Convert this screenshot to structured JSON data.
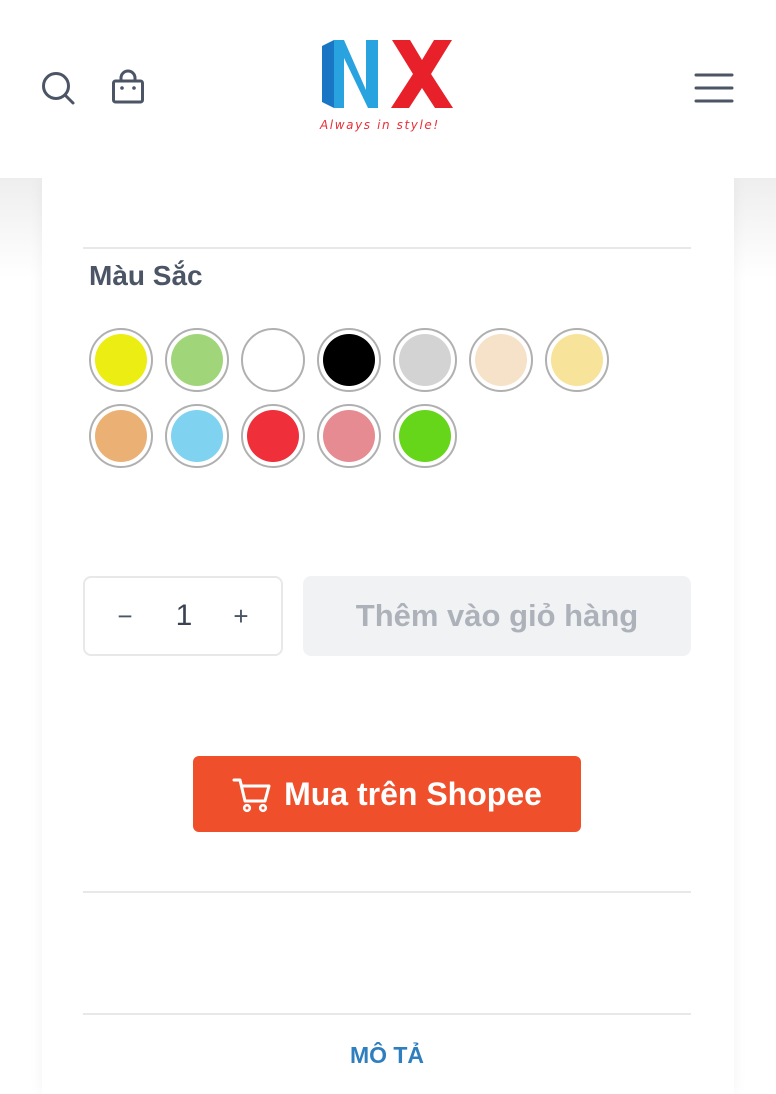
{
  "header": {
    "logo_tagline": "Always in style!",
    "brand_colors": {
      "blue": "#29a3e0",
      "dark_blue": "#1976c4",
      "red": "#e8202a"
    },
    "icons": [
      "search-icon",
      "shopping-bag-icon",
      "hamburger-menu-icon"
    ]
  },
  "product": {
    "color_label": "Màu Sắc",
    "swatches": [
      {
        "name": "yellow",
        "color": "#eced12"
      },
      {
        "name": "light-green",
        "color": "#a0d679"
      },
      {
        "name": "white",
        "color": "#ffffff"
      },
      {
        "name": "black",
        "color": "#000000"
      },
      {
        "name": "light-gray",
        "color": "#d3d3d3"
      },
      {
        "name": "beige",
        "color": "#f5e2c8"
      },
      {
        "name": "light-yellow",
        "color": "#f7e39a"
      },
      {
        "name": "peach",
        "color": "#ebb074"
      },
      {
        "name": "sky-blue",
        "color": "#7fd3f0"
      },
      {
        "name": "red",
        "color": "#ef2f3a"
      },
      {
        "name": "pink",
        "color": "#e68b91"
      },
      {
        "name": "green",
        "color": "#66d61b"
      }
    ],
    "quantity": {
      "minus": "−",
      "value": "1",
      "plus": "+"
    },
    "add_to_cart_label": "Thêm vào giỏ hàng",
    "shopee_button": {
      "label": "Mua trên Shopee",
      "color": "#ef4f2b",
      "icon": "shopping-cart-icon"
    },
    "description_tab": "MÔ TẢ"
  }
}
